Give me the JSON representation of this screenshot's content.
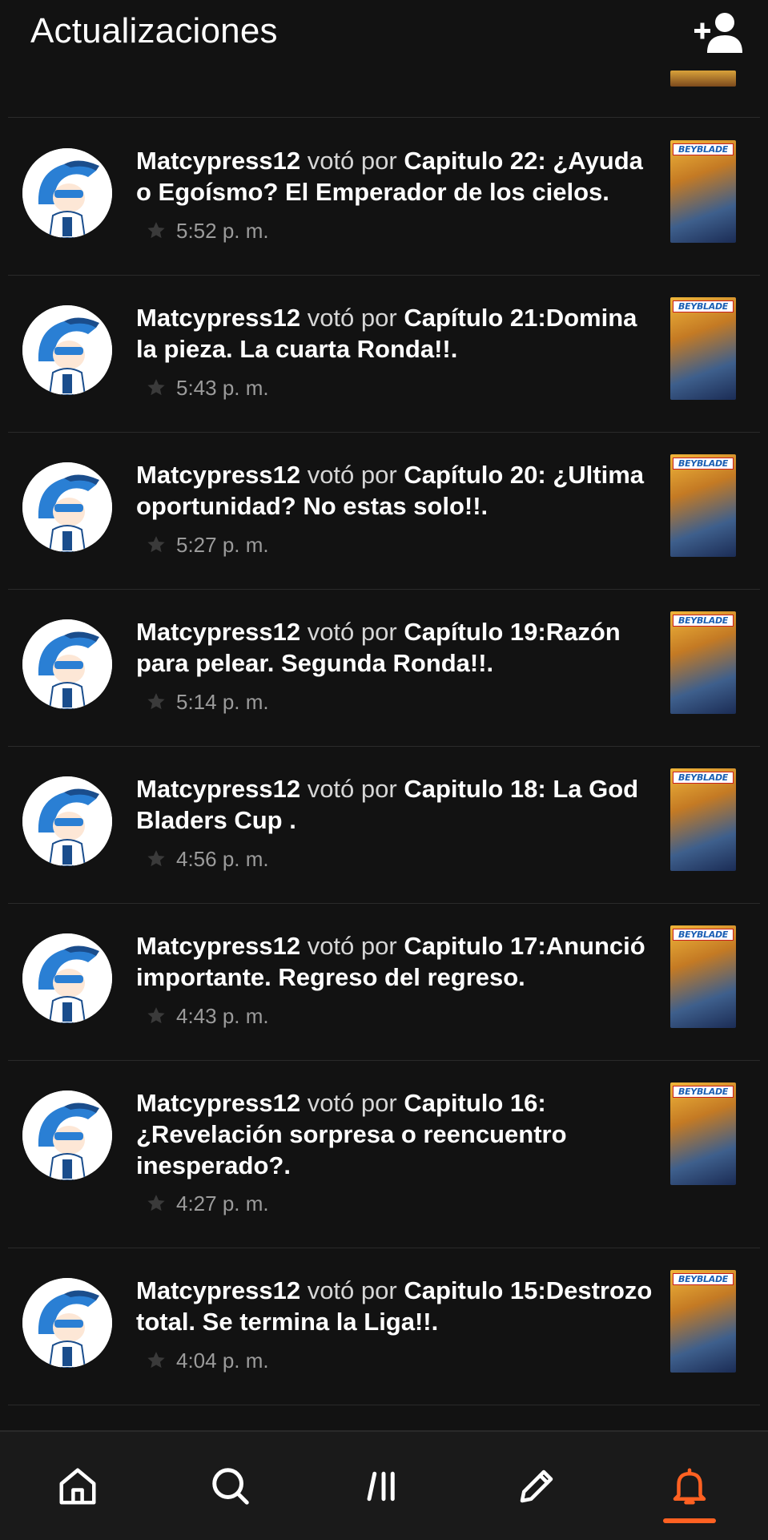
{
  "header": {
    "title": "Actualizaciones",
    "add_friend_icon": "add-user-icon"
  },
  "feed": {
    "items": [
      {
        "user": "Matcypress12",
        "verb": " votó por ",
        "chapter": "Capitulo 22: ¿Ayuda o Egoísmo? El Emperador de los cielos.",
        "time": "5:52 p. m.",
        "cover_label": "BEYBLADE"
      },
      {
        "user": "Matcypress12",
        "verb": " votó por ",
        "chapter": "Capítulo 21:Domina la pieza. La cuarta Ronda!!.",
        "time": "5:43 p. m.",
        "cover_label": "BEYBLADE"
      },
      {
        "user": "Matcypress12",
        "verb": " votó por ",
        "chapter": "Capítulo 20: ¿Ultima oportunidad? No estas solo!!.",
        "time": "5:27 p. m.",
        "cover_label": "BEYBLADE"
      },
      {
        "user": "Matcypress12",
        "verb": " votó por ",
        "chapter": "Capítulo 19:Razón para pelear. Segunda Ronda!!.",
        "time": "5:14 p. m.",
        "cover_label": "BEYBLADE"
      },
      {
        "user": "Matcypress12",
        "verb": " votó por ",
        "chapter": "Capitulo 18: La God Bladers Cup .",
        "time": "4:56 p. m.",
        "cover_label": "BEYBLADE"
      },
      {
        "user": "Matcypress12",
        "verb": " votó por ",
        "chapter": "Capitulo 17:Anunció importante. Regreso del regreso.",
        "time": "4:43 p. m.",
        "cover_label": "BEYBLADE"
      },
      {
        "user": "Matcypress12",
        "verb": " votó por ",
        "chapter": "Capitulo 16: ¿Revelación sorpresa o reencuentro inesperado?.",
        "time": "4:27 p. m.",
        "cover_label": "BEYBLADE"
      },
      {
        "user": "Matcypress12",
        "verb": " votó por ",
        "chapter": "Capitulo 15:Destrozo total. Se termina la Liga!!.",
        "time": "4:04 p. m.",
        "cover_label": "BEYBLADE"
      }
    ]
  },
  "bottom_nav": {
    "items": [
      {
        "icon": "home-icon",
        "active": false
      },
      {
        "icon": "search-icon",
        "active": false
      },
      {
        "icon": "library-icon",
        "active": false
      },
      {
        "icon": "pencil-icon",
        "active": false
      },
      {
        "icon": "bell-icon",
        "active": true
      }
    ],
    "accent_color": "#ff6122"
  },
  "colors": {
    "background": "#121212",
    "text_primary": "#ffffff",
    "text_secondary": "#9b9b9b",
    "divider": "#2a2a2a"
  }
}
